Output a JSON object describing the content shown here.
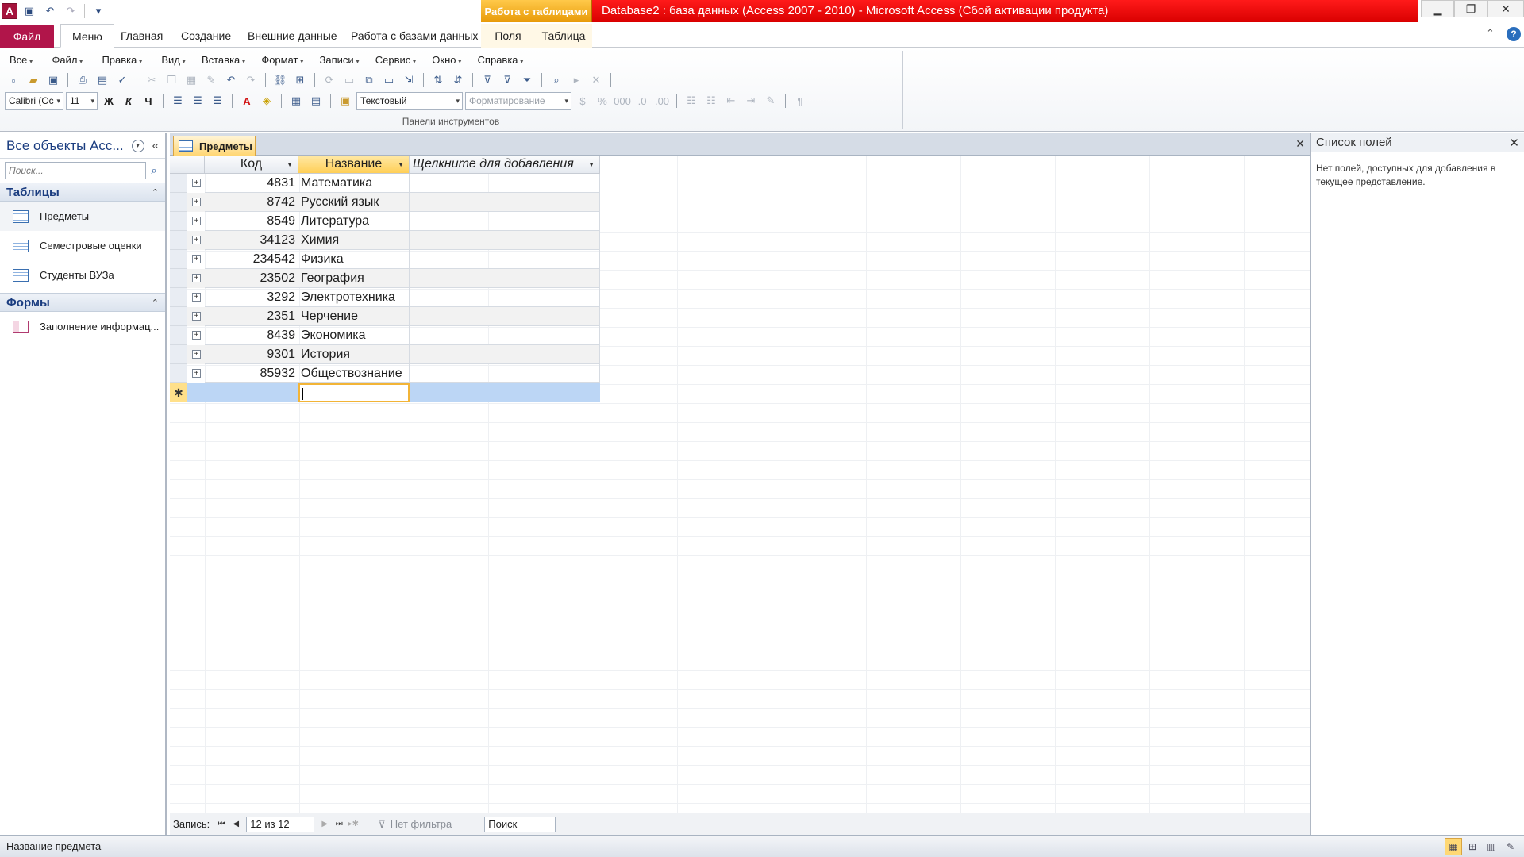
{
  "window": {
    "app_icon": "A",
    "context_tab": "Работа с таблицами",
    "title": "Database2 : база данных (Access 2007 - 2010)  -  Microsoft Access (Сбой активации продукта)",
    "accent_red": "#e81123",
    "accent_orange": "#f2a417"
  },
  "quick_access": {
    "icons": [
      "save-icon",
      "undo-icon",
      "redo-icon",
      "customize-icon"
    ]
  },
  "ribbon_tabs": [
    {
      "label": "Файл"
    },
    {
      "label": "Меню"
    },
    {
      "label": "Главная"
    },
    {
      "label": "Создание"
    },
    {
      "label": "Внешние данные"
    },
    {
      "label": "Работа с базами данных"
    },
    {
      "label": "Поля"
    },
    {
      "label": "Таблица"
    }
  ],
  "menubar": [
    "Все",
    "Файл",
    "Правка",
    "Вид",
    "Вставка",
    "Формат",
    "Записи",
    "Сервис",
    "Окно",
    "Справка"
  ],
  "toolbar": {
    "font_name": "Calibri (Ос",
    "font_size": "11",
    "bold": "Ж",
    "italic": "К",
    "underline": "Ч",
    "data_type": "Текстовый",
    "format": "Форматирование",
    "group_label": "Панели инструментов"
  },
  "nav_pane": {
    "title": "Все объекты Acc...",
    "search_placeholder": "Поиск...",
    "groups": [
      {
        "title": "Таблицы",
        "items": [
          "Предметы",
          "Семестровые оценки",
          "Студенты ВУЗа"
        ]
      },
      {
        "title": "Формы",
        "items": [
          "Заполнение информац..."
        ]
      }
    ]
  },
  "document": {
    "tab_title": "Предметы",
    "columns": [
      "Код",
      "Название",
      "Щелкните для добавления"
    ],
    "rows": [
      {
        "code": "4831",
        "name": "Математика"
      },
      {
        "code": "8742",
        "name": "Русский язык"
      },
      {
        "code": "8549",
        "name": "Литература"
      },
      {
        "code": "34123",
        "name": "Химия"
      },
      {
        "code": "234542",
        "name": "Физика"
      },
      {
        "code": "23502",
        "name": "География"
      },
      {
        "code": "3292",
        "name": "Электротехника"
      },
      {
        "code": "2351",
        "name": "Черчение"
      },
      {
        "code": "8439",
        "name": "Экономика"
      },
      {
        "code": "9301",
        "name": "История"
      },
      {
        "code": "85932",
        "name": "Обществознание"
      }
    ],
    "new_row_marker": "✱"
  },
  "record_nav": {
    "label": "Запись:",
    "position": "12 из 12",
    "filter": "Нет фильтра",
    "search": "Поиск"
  },
  "field_list": {
    "title": "Список полей",
    "message": "Нет полей, доступных для добавления в текущее представление."
  },
  "status": {
    "text": "Название предмета"
  }
}
